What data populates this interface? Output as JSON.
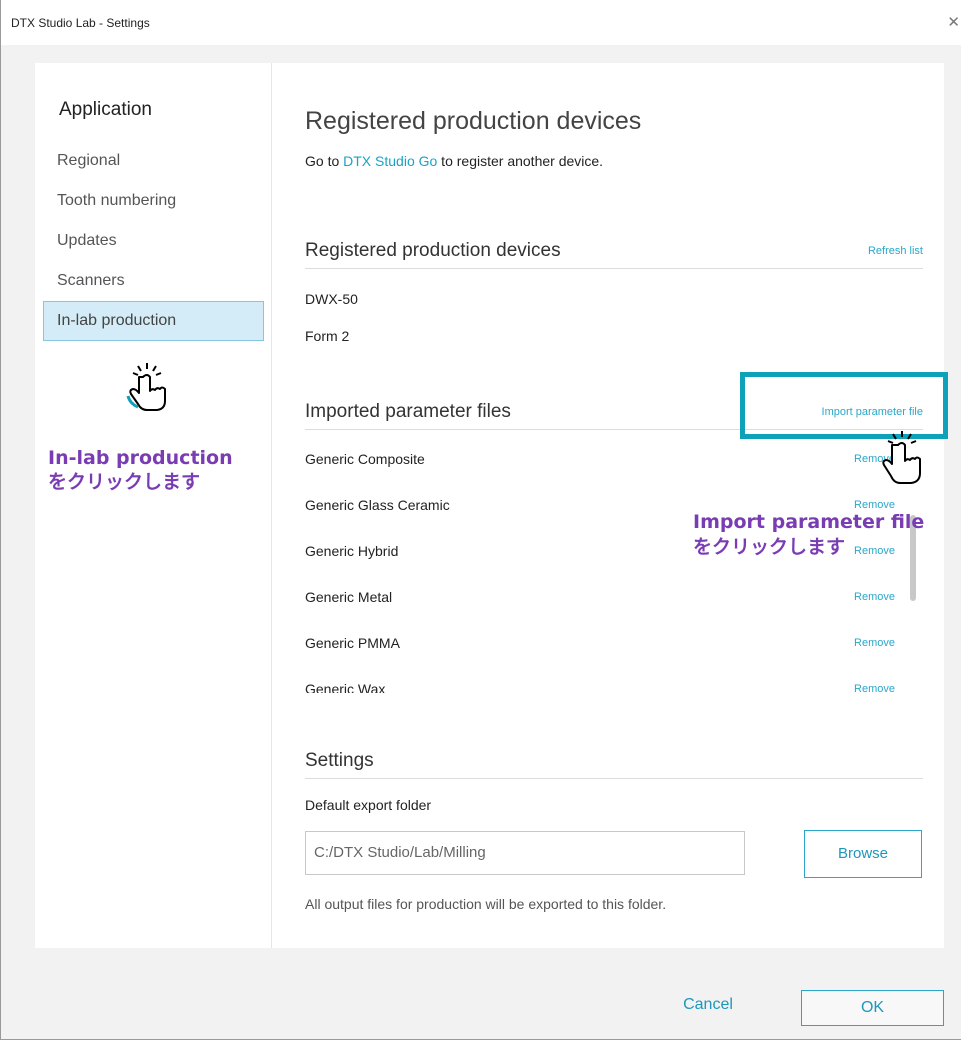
{
  "window": {
    "title": "DTX Studio Lab - Settings",
    "close_glyph": "✕"
  },
  "sidebar": {
    "heading": "Application",
    "items": [
      {
        "label": "Regional"
      },
      {
        "label": "Tooth numbering"
      },
      {
        "label": "Updates"
      },
      {
        "label": "Scanners"
      },
      {
        "label": "In-lab production",
        "selected": true
      }
    ]
  },
  "main": {
    "title": "Registered production devices",
    "subtitle_prefix": "Go to ",
    "subtitle_link": "DTX Studio Go",
    "subtitle_suffix": " to register another device."
  },
  "devices_section": {
    "heading": "Registered production devices",
    "action": "Refresh list",
    "devices": [
      "DWX-50",
      "Form 2"
    ]
  },
  "params_section": {
    "heading": "Imported parameter files",
    "action": "Import parameter file",
    "files": [
      {
        "name": "Generic Composite",
        "action": "Remove"
      },
      {
        "name": "Generic Glass Ceramic",
        "action": "Remove"
      },
      {
        "name": "Generic Hybrid",
        "action": "Remove"
      },
      {
        "name": "Generic Metal",
        "action": "Remove"
      },
      {
        "name": "Generic PMMA",
        "action": "Remove"
      },
      {
        "name": "Generic Wax",
        "action": "Remove"
      }
    ]
  },
  "settings_section": {
    "heading": "Settings",
    "folder_label": "Default export folder",
    "folder_value": "C:/DTX Studio/Lab/Milling",
    "browse_label": "Browse",
    "note": "All output files for production will be exported to this folder."
  },
  "footer": {
    "cancel_label": "Cancel",
    "ok_label": "OK"
  },
  "annotations": {
    "left_line1": "In-lab production",
    "left_line2": "をクリックします",
    "right_line1": "Import parameter file",
    "right_line2": "をクリックします"
  },
  "colors": {
    "accent": "#2aa7c8",
    "highlight": "#0fa1ba",
    "annotation": "#7a3cb3",
    "selected_bg": "#d4ecf7"
  },
  "icons": [
    "close-icon",
    "pointer-hand-icon"
  ]
}
